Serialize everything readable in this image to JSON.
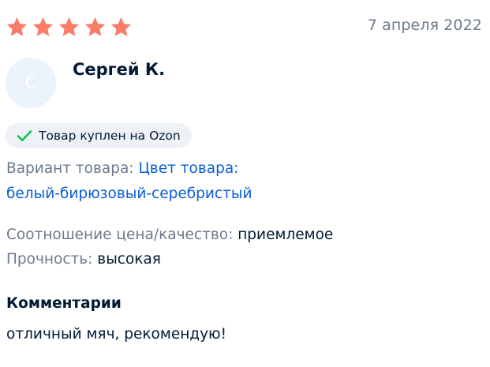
{
  "colors": {
    "star": "#f97c68",
    "check": "#10c44c",
    "link": "#0a5dd9",
    "muted": "#6b7a8c",
    "text": "#001a34"
  },
  "rating": {
    "value": 5,
    "max": 5,
    "icon": "star-icon"
  },
  "date": "7 апреля 2022",
  "author": {
    "initial": "С",
    "name": "Сергей К."
  },
  "purchase_badge": {
    "icon": "checkmark-icon",
    "label": "Товар куплен на Ozon"
  },
  "variant": {
    "label": "Вариант товара:",
    "value_line1": "Цвет товара:",
    "value_line2": "белый-бирюзовый-серебристый"
  },
  "ratings": [
    {
      "label": "Соотношение цена/качество:",
      "value": "приемлемое"
    },
    {
      "label": "Прочность:",
      "value": "высокая"
    }
  ],
  "comment": {
    "title": "Комментарии",
    "text": "отличный мяч, рекомендую!"
  }
}
